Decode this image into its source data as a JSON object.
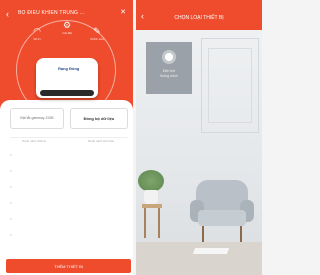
{
  "left_screen": {
    "header": {
      "back_icon": "back-arrow-icon",
      "title": "BỘ ĐIỀU KHIỂN TRUNG ...",
      "close_icon": "close-icon",
      "icons": [
        {
          "icon": "wifi-icon",
          "label": "Wi-Fi"
        },
        {
          "icon": "settings-icon",
          "label": "Cài đặt"
        },
        {
          "icon": "edit-icon",
          "label": "Chỉnh sửa"
        }
      ],
      "device_brand": "Rạng Đông",
      "accent": "#ee4c2c"
    },
    "buttons": {
      "left_label": "Bật tắt gateway ZIGB",
      "right_label": "Đồng bộ dữ liệu"
    },
    "list_headers": {
      "left": "Danh sách thiết bị",
      "right": "Danh sách kịch bản"
    },
    "bottom_button": "THÊM THIẾT BỊ"
  },
  "right_screen": {
    "header": {
      "back_icon": "back-arrow-icon",
      "title": "CHỌN LOẠI THIẾT BỊ",
      "accent": "#ee4c2c"
    },
    "tile": {
      "icon": "device-circle-icon",
      "label": "Đèn led\nthông minh"
    }
  }
}
